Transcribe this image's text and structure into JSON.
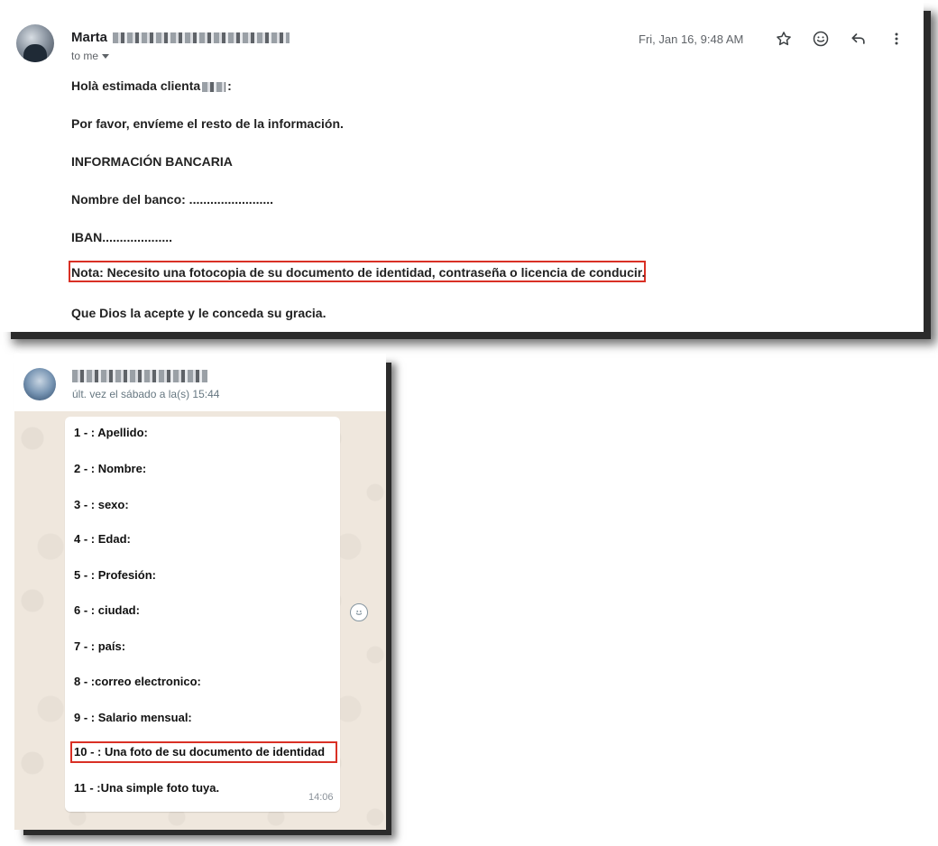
{
  "email": {
    "sender_name": "Marta",
    "recipient": "to me",
    "date": "Fri, Jan 16, 9:48 AM",
    "icons": [
      "star-icon",
      "emoji-icon",
      "reply-icon",
      "more-vert-icon"
    ],
    "greeting_prefix": "Holà estimada clienta",
    "greeting_suffix": ":",
    "lines": [
      "Por favor, envíeme el resto de la información.",
      "INFORMACIÓN BANCARIA",
      "Nombre del banco: ........................",
      "IBAN...................."
    ],
    "note": "Nota: Necesito una fotocopia de su documento de identidad, contraseña o licencia de conducir.",
    "closing": "Que Dios la acepte y le conceda su gracia.",
    "highlight_color": "#d93025"
  },
  "whatsapp": {
    "last_seen": "últ. vez el sábado a la(s) 15:44",
    "items": [
      "1 -  : Apellido:",
      "2 -  : Nombre:",
      "3 -  : sexo:",
      "4 -  : Edad:",
      "5 -  : Profesión:",
      "6 - : ciudad:",
      "7 -  : país:",
      "8 -  :correo electronico:",
      "9 -  : Salario mensual:",
      "10 -  : Una foto de su documento de identidad",
      "11 -  :Una simple foto tuya."
    ],
    "time": "14:06",
    "highlighted_item_index": 9,
    "background_color": "#efe7dd"
  }
}
